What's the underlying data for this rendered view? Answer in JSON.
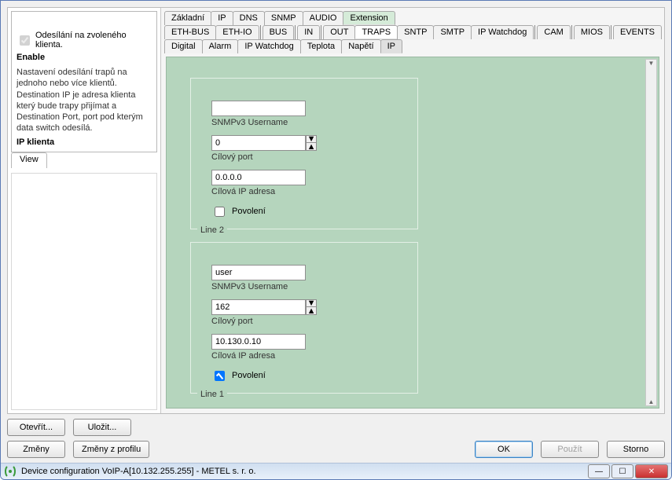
{
  "window": {
    "title": "Device configuration VoIP-A[10.132.255.255] - METEL s. r. o."
  },
  "toolbar": {
    "zmeny": "Změny",
    "zmeny_z_profilu": "Změny z profilu",
    "otevrit": "Otevřít...",
    "ulozit": "Uložit...",
    "ok": "OK",
    "pouzit": "Použít",
    "storno": "Storno"
  },
  "top_tabs": {
    "zakladni": "Základní",
    "ip": "IP",
    "dns": "DNS",
    "snmp": "SNMP",
    "audio": "AUDIO",
    "extension": "Extension"
  },
  "ext_tabs": {
    "eth_bus": "ETH-BUS",
    "eth_io": "ETH-IO",
    "bus": "BUS",
    "in": "IN",
    "out": "OUT",
    "traps": "TRAPS",
    "sntp": "SNTP",
    "smtp": "SMTP",
    "ip_watchdog": "IP Watchdog",
    "cam": "CAM",
    "mios": "MIOS",
    "events": "EVENTS"
  },
  "trap_tabs": {
    "digital": "Digital",
    "alarm": "Alarm",
    "ip_watchdog": "IP Watchdog",
    "teplota": "Teplota",
    "napeti": "Napětí",
    "ip": "IP"
  },
  "form": {
    "line1": {
      "legend": "Line 1",
      "povoleni_label": "Povolení",
      "povoleni_checked": true,
      "cilova_ip_label": "Cílová IP adresa",
      "cilova_ip": "10.130.0.10",
      "cilovy_port_label": "Cílový port",
      "cilovy_port": "162",
      "snmpv3_user_label": "SNMPv3 Username",
      "snmpv3_user": "user"
    },
    "line2": {
      "legend": "Line 2",
      "povoleni_label": "Povolení",
      "povoleni_checked": false,
      "cilova_ip_label": "Cílová IP adresa",
      "cilova_ip": "0.0.0.0",
      "cilovy_port_label": "Cílový port",
      "cilovy_port": "0",
      "snmpv3_user_label": "SNMPv3 Username",
      "snmpv3_user": ""
    }
  },
  "left": {
    "view_tab": "View",
    "help_title": "IP klienta",
    "help_text": "Nastavení odesílání trapů na jednoho nebo více klientů. Destination IP je adresa klienta který bude trapy přijímat a Destination Port, port pod kterým data switch odesílá.",
    "enable_label": "Enable",
    "enable_desc_label": "Odesílání na zvoleného klienta."
  }
}
